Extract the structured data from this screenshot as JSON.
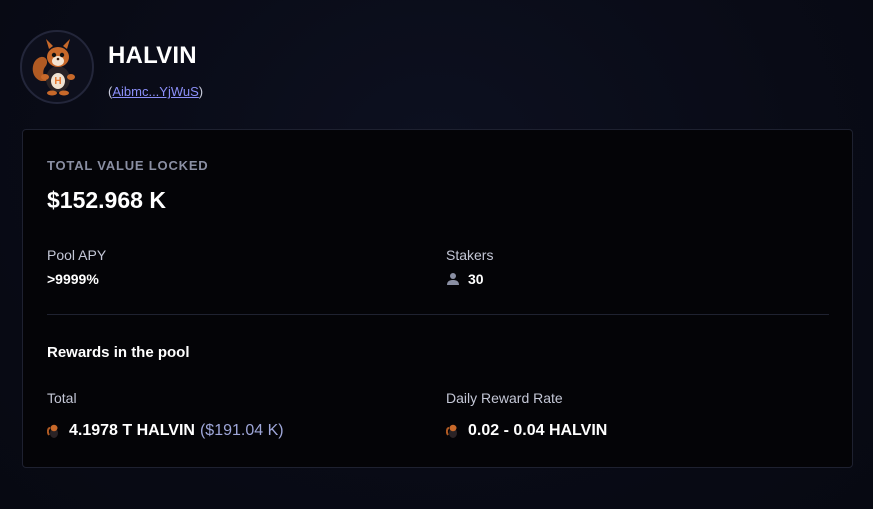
{
  "token": {
    "name": "HALVIN",
    "address_open": "(",
    "address_short": "Aibmc...YjWuS",
    "address_close": ")"
  },
  "tvl": {
    "label": "TOTAL VALUE LOCKED",
    "value": "$152.968 K"
  },
  "pool_apy": {
    "label": "Pool APY",
    "value": ">9999%"
  },
  "stakers": {
    "label": "Stakers",
    "value": "30",
    "icon": "user-icon"
  },
  "rewards": {
    "title": "Rewards in the pool",
    "total_label": "Total",
    "total_value": "4.1978 T HALVIN",
    "total_usd": "($191.04 K)",
    "daily_label": "Daily Reward Rate",
    "daily_value": "0.02 - 0.04 HALVIN"
  },
  "colors": {
    "background": "#090b16",
    "card": "#040407",
    "link": "#8b8ff9",
    "muted_label": "#8a8fa3"
  }
}
